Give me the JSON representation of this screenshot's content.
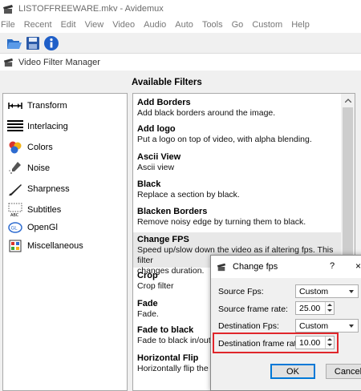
{
  "window": {
    "title": "LISTOFFREEWARE.mkv - Avidemux"
  },
  "menu": [
    "File",
    "Recent",
    "Edit",
    "View",
    "Video",
    "Audio",
    "Auto",
    "Tools",
    "Go",
    "Custom",
    "Help"
  ],
  "toolbar": {
    "icons": [
      "open-folder-icon",
      "save-disk-icon",
      "info-icon"
    ]
  },
  "filter_manager": {
    "title": "Video Filter Manager",
    "available_label": "Available Filters",
    "categories": [
      {
        "label": "Transform",
        "icon": "transform-icon"
      },
      {
        "label": "Interlacing",
        "icon": "interlacing-icon"
      },
      {
        "label": "Colors",
        "icon": "colors-icon"
      },
      {
        "label": "Noise",
        "icon": "noise-icon"
      },
      {
        "label": "Sharpness",
        "icon": "sharpness-icon"
      },
      {
        "label": "Subtitles",
        "icon": "subtitles-icon"
      },
      {
        "label": "OpenGl",
        "icon": "opengl-icon"
      },
      {
        "label": "Miscellaneous",
        "icon": "miscellaneous-icon"
      }
    ],
    "filters": [
      {
        "name": "Add Borders",
        "desc": [
          "Add black borders around the image."
        ]
      },
      {
        "name": "Add logo",
        "desc": [
          "Put a logo on top of video, with alpha blending."
        ]
      },
      {
        "name": "Ascii View",
        "desc": [
          "Ascii view"
        ]
      },
      {
        "name": "Black",
        "desc": [
          "Replace a section by black."
        ]
      },
      {
        "name": "Blacken Borders",
        "desc": [
          "Remove noisy edge by turning them to black."
        ]
      },
      {
        "name": "Change FPS",
        "desc": [
          "Speed up/slow down the video as if altering fps. This filter",
          "changes duration."
        ]
      },
      {
        "name": "Crop",
        "desc": [
          "Crop filter"
        ]
      },
      {
        "name": "Fade",
        "desc": [
          "Fade."
        ]
      },
      {
        "name": "Fade to black",
        "desc": [
          "Fade to black in/out."
        ]
      },
      {
        "name": "Horizontal Flip",
        "desc": [
          "Horizontally flip the image."
        ]
      }
    ]
  },
  "dialog": {
    "title": "Change fps",
    "help": "?",
    "close": "×",
    "source_fps_label": "Source Fps:",
    "source_fps_value": "Custom",
    "source_rate_label": "Source frame rate:",
    "source_rate_value": "25.00",
    "dest_fps_label": "Destination Fps:",
    "dest_fps_value": "Custom",
    "dest_rate_label": "Destination frame rate:",
    "dest_rate_value": "10.00",
    "ok": "OK",
    "cancel": "Cancel",
    "highlight_color": "#e0262b"
  }
}
